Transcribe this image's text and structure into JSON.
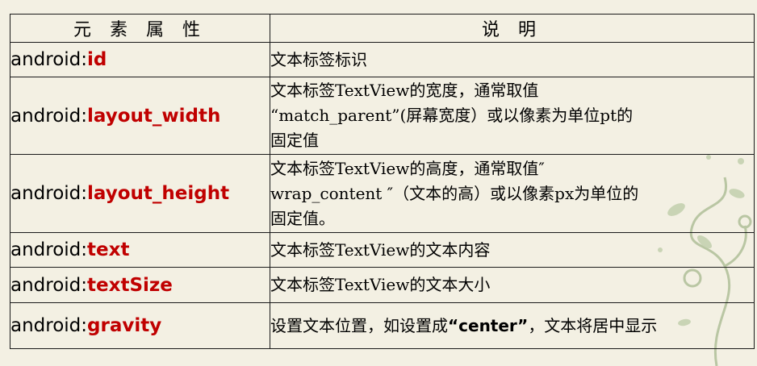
{
  "table": {
    "headers": [
      "元 素 属 性",
      "说  明"
    ],
    "rows": [
      {
        "prefix": "android:",
        "name": "id",
        "desc": [
          "文本标签标识"
        ]
      },
      {
        "prefix": "android:",
        "name": "layout_width",
        "desc": [
          "文本标签TextView的宽度，通常取值",
          "“match_parent”(屏幕宽度）或以像素为单位pt的",
          "固定值"
        ]
      },
      {
        "prefix": "android:",
        "name": "layout_height",
        "desc": [
          "文本标签TextView的高度，通常取值″",
          "wrap_content ″（文本的高）或以像素px为单位的",
          "固定值。"
        ]
      },
      {
        "prefix": "android:",
        "name": "text",
        "desc": [
          "文本标签TextView的文本内容"
        ]
      },
      {
        "prefix": "android:",
        "name": "textSize",
        "desc": [
          "文本标签TextView的文本大小"
        ]
      },
      {
        "prefix": "android:",
        "name": "gravity",
        "desc_parts": [
          "设置文本位置，如设置成",
          "“center”",
          "，文本将居中显示"
        ]
      }
    ]
  },
  "colors": {
    "background": "#f3f0e3",
    "attr_name": "#c00000",
    "border": "#1a1a1a",
    "decor": "#b9c6a3"
  },
  "icons": [
    "vine-decoration"
  ]
}
